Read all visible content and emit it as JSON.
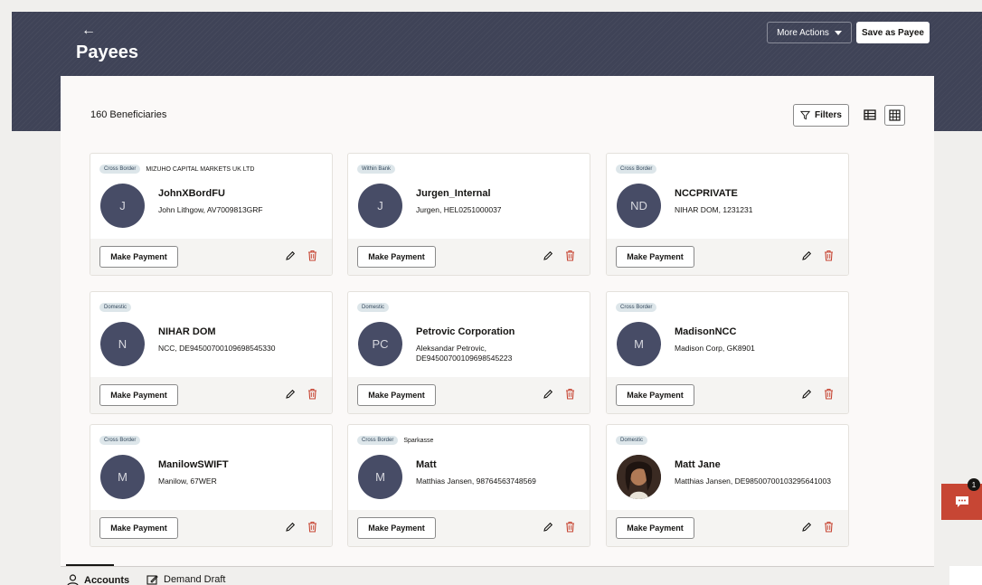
{
  "header": {
    "back_glyph": "←",
    "title": "Payees",
    "more_actions_label": "More Actions",
    "save_as_payee_label": "Save as Payee"
  },
  "toolbar": {
    "count_label": "160 Beneficiaries",
    "filters_label": "Filters"
  },
  "payees": [
    {
      "type": "Cross Border",
      "bank": "MIZUHO CAPITAL MARKETS UK LTD",
      "initials": "J",
      "name": "JohnXBordFU",
      "desc": "John Lithgow, AV7009813GRF",
      "action": "Make Payment"
    },
    {
      "type": "Within Bank",
      "bank": "",
      "initials": "J",
      "name": "Jurgen_Internal",
      "desc": "Jurgen, HEL0251000037",
      "action": "Make Payment"
    },
    {
      "type": "Cross Border",
      "bank": "",
      "initials": "ND",
      "name": "NCCPRIVATE",
      "desc": "NIHAR DOM, 1231231",
      "action": "Make Payment"
    },
    {
      "type": "Domestic",
      "bank": "",
      "initials": "N",
      "name": "NIHAR DOM",
      "desc": "NCC, DE94500700109698545330",
      "action": "Make Payment"
    },
    {
      "type": "Domestic",
      "bank": "",
      "initials": "PC",
      "name": "Petrovic Corporation",
      "desc": "Aleksandar Petrovic, DE94500700109698545223",
      "action": "Make Payment"
    },
    {
      "type": "Cross Border",
      "bank": "",
      "initials": "M",
      "name": "MadisonNCC",
      "desc": "Madison Corp, GK8901",
      "action": "Make Payment"
    },
    {
      "type": "Cross Border",
      "bank": "",
      "initials": "M",
      "name": "ManilowSWIFT",
      "desc": "Manilow, 67WER",
      "action": "Make Payment"
    },
    {
      "type": "Cross Border",
      "bank": "Sparkasse",
      "initials": "M",
      "name": "Matt",
      "desc": "Matthias Jansen, 98764563748569",
      "action": "Make Payment"
    },
    {
      "type": "Domestic",
      "bank": "",
      "initials": "",
      "name": "Matt Jane",
      "desc": "Matthias Jansen, DE98500700103295641003",
      "action": "Make Payment"
    }
  ],
  "bottom_tabs": {
    "accounts": "Accounts",
    "demand_draft": "Demand Draft"
  },
  "chat": {
    "count": "1"
  },
  "colors": {
    "header_bg": "#3f4357",
    "avatar_bg": "#474c66",
    "delete_icon": "#c74634",
    "chat_bg": "#c74634"
  }
}
